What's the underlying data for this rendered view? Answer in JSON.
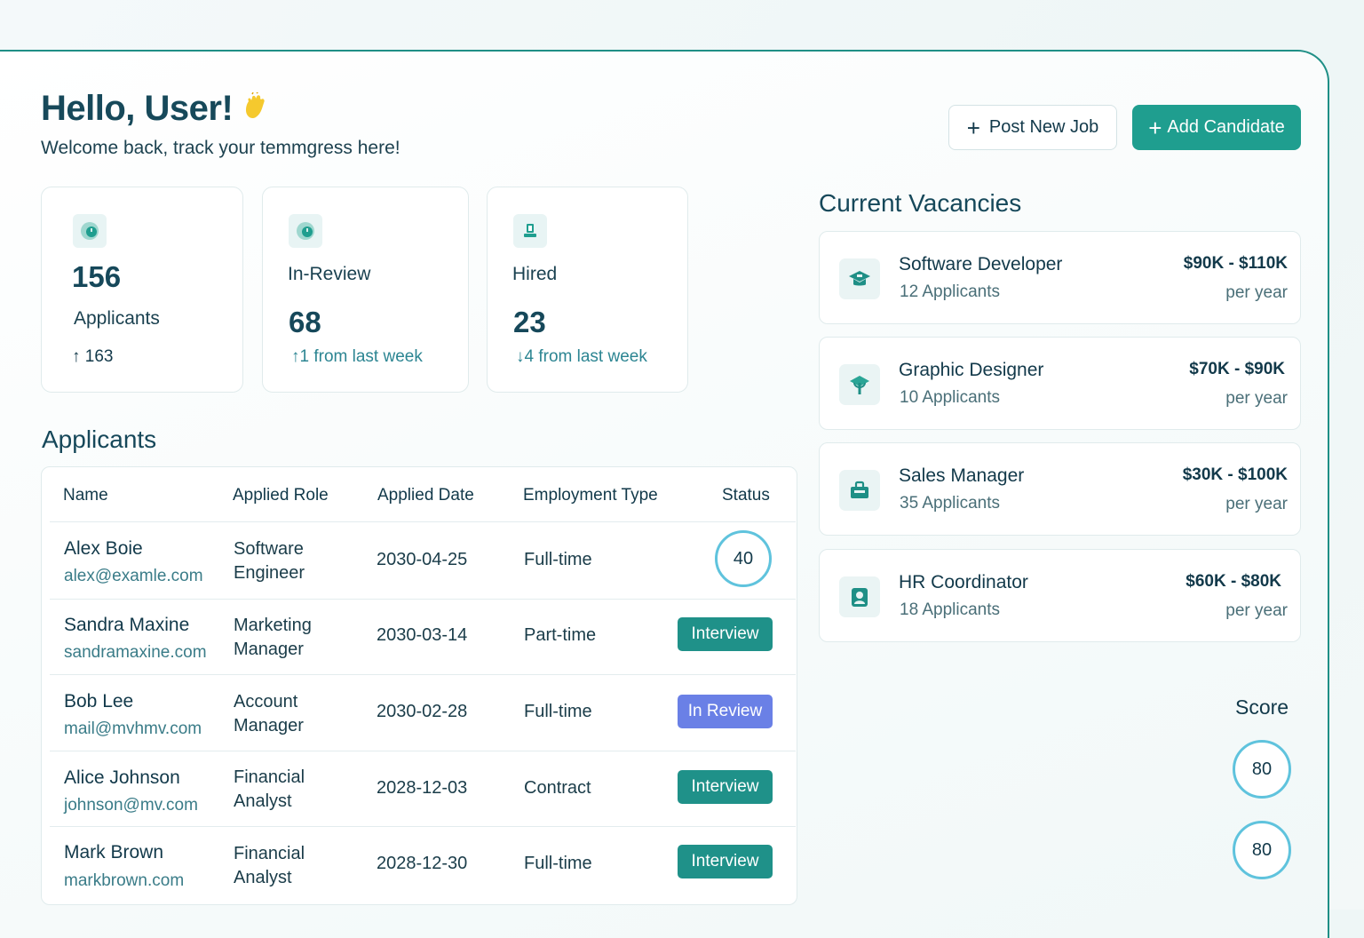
{
  "header": {
    "greeting": "Hello, User!",
    "subtitle": "Welcome back, track your temmgress here!",
    "post_job_label": "Post New Job",
    "add_candidate_label": "Add Candidate"
  },
  "stats": [
    {
      "value": "156",
      "label": "Applicants",
      "delta": "163",
      "delta_dir": "up"
    },
    {
      "value": "68",
      "label": "In-Review",
      "delta": "1 from last week",
      "delta_dir": "up"
    },
    {
      "value": "23",
      "label": "Hired",
      "delta": "4 from last week",
      "delta_dir": "down"
    }
  ],
  "applicants": {
    "title": "Applicants",
    "columns": [
      "Name",
      "Applied Role",
      "Applied Date",
      "Employment Type",
      "Status"
    ],
    "rows": [
      {
        "name": "Alex Boie",
        "email": "alex@examle.com",
        "role_line1": "Software",
        "role_line2": "Engineer",
        "date": "2030-04-25",
        "type": "Full-time",
        "status": "40",
        "status_kind": "score"
      },
      {
        "name": "Sandra Maxine",
        "email": "sandramaxine.com",
        "role_line1": "Marketing",
        "role_line2": "Manager",
        "date": "2030-03-14",
        "type": "Part-time",
        "status": "Interview",
        "status_kind": "interview"
      },
      {
        "name": "Bob Lee",
        "email": "mail@mvhmv.com",
        "role_line1": "Account",
        "role_line2": "Manager",
        "date": "2030-02-28",
        "type": "Full-time",
        "status": "In Review",
        "status_kind": "review"
      },
      {
        "name": "Alice Johnson",
        "email": "johnson@mv.com",
        "role_line1": "Financial",
        "role_line2": "Analyst",
        "date": "2028-12-03",
        "type": "Contract",
        "status": "Interview",
        "status_kind": "interview"
      },
      {
        "name": "Mark Brown",
        "email": "markbrown.com",
        "role_line1": "Financial",
        "role_line2": "Analyst",
        "date": "2028-12-30",
        "type": "Full-time",
        "status": "Interview",
        "status_kind": "interview"
      }
    ]
  },
  "vacancies": {
    "title": "Current Vacancies",
    "items": [
      {
        "title": "Software Developer",
        "applicants": "12 Applicants",
        "salary": "$90K - $110K",
        "period": "per year",
        "icon": "graduation-cap-icon"
      },
      {
        "title": "Graphic Designer",
        "applicants": "10 Applicants",
        "salary": "$70K - $90K",
        "period": "per year",
        "icon": "design-plant-icon"
      },
      {
        "title": "Sales Manager",
        "applicants": "35 Applicants",
        "salary": "$30K - $100K",
        "period": "per year",
        "icon": "briefcase-icon"
      },
      {
        "title": "HR Coordinator",
        "applicants": "18 Applicants",
        "salary": "$60K - $80K",
        "period": "per year",
        "icon": "person-badge-icon"
      }
    ]
  },
  "score": {
    "label": "Score",
    "values": [
      "80",
      "80"
    ]
  },
  "colors": {
    "accent": "#1f9e8f",
    "interview_badge": "#1f9189",
    "review_badge": "#6a80e6",
    "score_ring": "#5fc3dd",
    "heading": "#16485a"
  }
}
